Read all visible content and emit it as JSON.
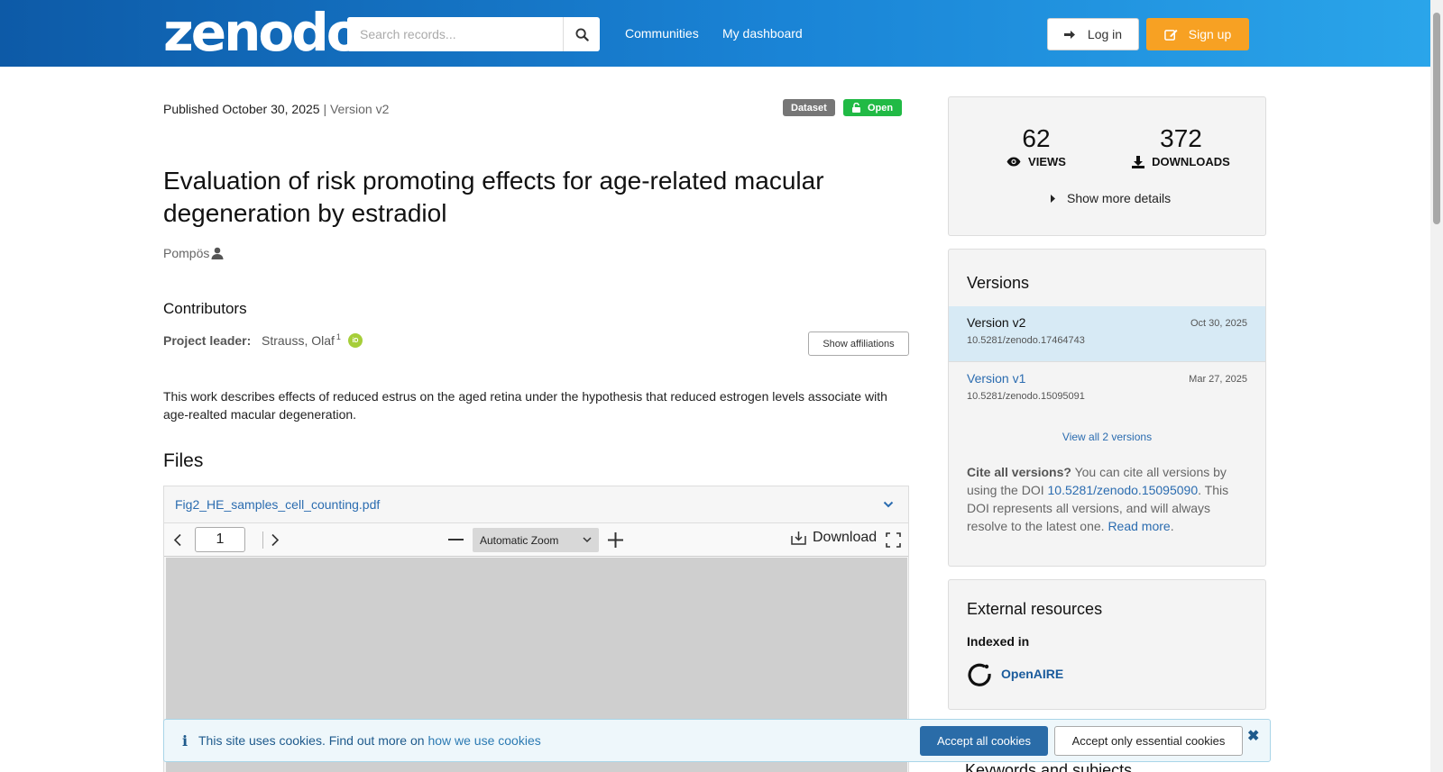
{
  "header": {
    "logo": "zenodo",
    "search_placeholder": "Search records...",
    "nav": [
      "Communities",
      "My dashboard"
    ],
    "login_label": "Log in",
    "signup_label": "Sign up"
  },
  "record": {
    "published_label": "Published October 30, 2025",
    "version_label": "| Version v2",
    "badge_type": "Dataset",
    "badge_access": "Open",
    "title": "Evaluation of risk promoting effects for age-related macular degeneration by estradiol",
    "author": "Pompös",
    "contributors_heading": "Contributors",
    "contributor_role": "Project leader:",
    "contributor_name": "Strauss, Olaf",
    "contributor_affil_sup": "1",
    "show_affiliations_label": "Show affiliations",
    "description": "This work describes effects of reduced estrus on the aged retina under the hypothesis that reduced estrogen levels associate with age-realted macular degeneration."
  },
  "files": {
    "heading": "Files",
    "filename": "Fig2_HE_samples_cell_counting.pdf",
    "page_number": "1",
    "zoom": "Automatic Zoom",
    "download_label": "Download"
  },
  "cookie": {
    "message": "This site uses cookies. Find out more on",
    "link": "how we use cookies",
    "accept_all": "Accept all cookies",
    "accept_essential": "Accept only essential cookies"
  },
  "sidebar": {
    "views": "62",
    "views_label": "VIEWS",
    "downloads": "372",
    "downloads_label": "DOWNLOADS",
    "show_more": "Show more details",
    "versions_heading": "Versions",
    "versions": [
      {
        "name": "Version v2",
        "date": "Oct 30, 2025",
        "doi": "10.5281/zenodo.17464743"
      },
      {
        "name": "Version v1",
        "date": "Mar 27, 2025",
        "doi": "10.5281/zenodo.15095091"
      }
    ],
    "view_all": "View all 2 versions",
    "cite_bold": "Cite all versions?",
    "cite_text1": "You can cite all versions by using the DOI",
    "cite_doi": "10.5281/zenodo.15095090",
    "cite_text2": ". This DOI represents all versions, and will always resolve to the latest one.",
    "read_more": "Read more",
    "external_heading": "External resources",
    "indexed_in": "Indexed in",
    "openaire": "OpenAIRE",
    "keywords_heading": "Keywords and subjects"
  },
  "colors": {
    "header_start": "#0d5aa7",
    "header_end": "#2aa5ea",
    "signup": "#f7a123",
    "open_badge": "#21ba45",
    "link": "#2b6cb0"
  }
}
